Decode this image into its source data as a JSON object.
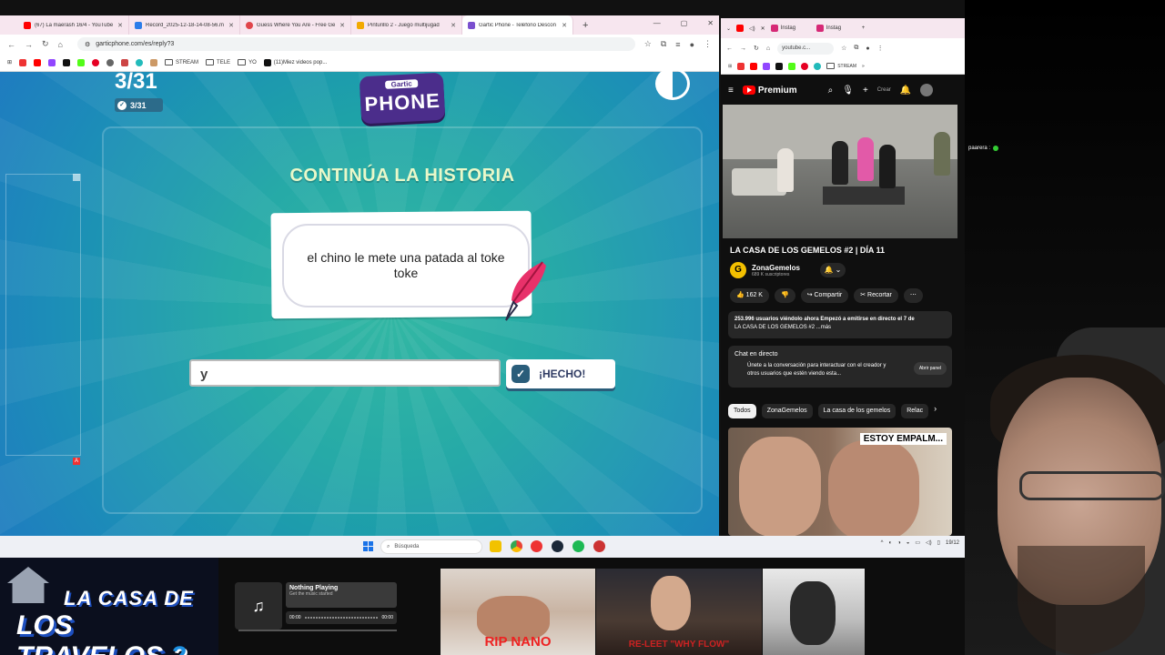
{
  "left_browser": {
    "tabs": [
      {
        "label": "(67) La maerash 16/4 - YouTube",
        "color": "#ff0000"
      },
      {
        "label": "Record_2025-12-18-14-08-56.m",
        "color": "#2b7de9"
      },
      {
        "label": "Guess Where You Are - Free Ge",
        "color": "#e0454b"
      },
      {
        "label": "Pinturillo 2 - Juego multijugad",
        "color": "#f2a900"
      },
      {
        "label": "Gartic Phone - Teléfono Descon",
        "color": "#7a4fcf"
      }
    ],
    "url": "garticphone.com/es/reply?3",
    "bookmarks": [
      {
        "label": "STREAM",
        "type": "folder"
      },
      {
        "label": "TELE",
        "type": "folder"
      },
      {
        "label": "YO",
        "type": "folder"
      },
      {
        "label": "(11)Miez videos pop...",
        "type": "link"
      }
    ]
  },
  "game": {
    "round_big": "3/31",
    "round_small": "3/31",
    "logo_top": "Gartic",
    "logo_bottom": "PHONE",
    "headline": "CONTINÚA LA HISTORIA",
    "prompt_text": "el chino le mete una patada al toke toke",
    "answer_value": "y",
    "done_label": "¡HECHO!",
    "side_marker": "A"
  },
  "right_browser": {
    "tabs": [
      "Instag",
      "Instag"
    ],
    "url": "youtube.c...",
    "bookmarks_folder": "STREAM",
    "brand": "Premium",
    "create_label": "Crear",
    "video_title": "LA CASA DE LOS GEMELOS #2 | DÍA 11",
    "channel_name": "ZonaGemelos",
    "channel_initial": "G",
    "subscribers": "689 K suscriptores",
    "likes": "162 K",
    "share_label": "Compartir",
    "clip_label": "Recortar",
    "description": "253.996 usuarios viéndolo ahora  Empezó a emitirse en directo el 7 de",
    "description_2": "LA CASA DE LOS GEMELOS #2 ...más",
    "chat_title": "Chat en directo",
    "chat_text": "Únete a la conversación para interactuar con el creador y otros usuarios que estén viendo esta...",
    "open_panel": "Abrir panel",
    "chips": [
      "Todos",
      "ZonaGemelos",
      "La casa de los gemelos",
      "Relac"
    ],
    "thumb_label": "ESTOY EMPALM..."
  },
  "webcam": {
    "chat_user": "paarera :"
  },
  "taskbar": {
    "search_placeholder": "Búsqueda",
    "clock": "19/12"
  },
  "overlay": {
    "brand_line1": "LA CASA DE",
    "brand_line2": "LOS TRAVELOS",
    "brand_number": "2",
    "music_title": "Nothing Playing",
    "music_sub": "Get the music started",
    "time_start": "00:00",
    "time_end": "00:00",
    "clip1_caption": "RIP NANO",
    "clip2_caption": "RE-LEET \"WHY FLOW\""
  }
}
